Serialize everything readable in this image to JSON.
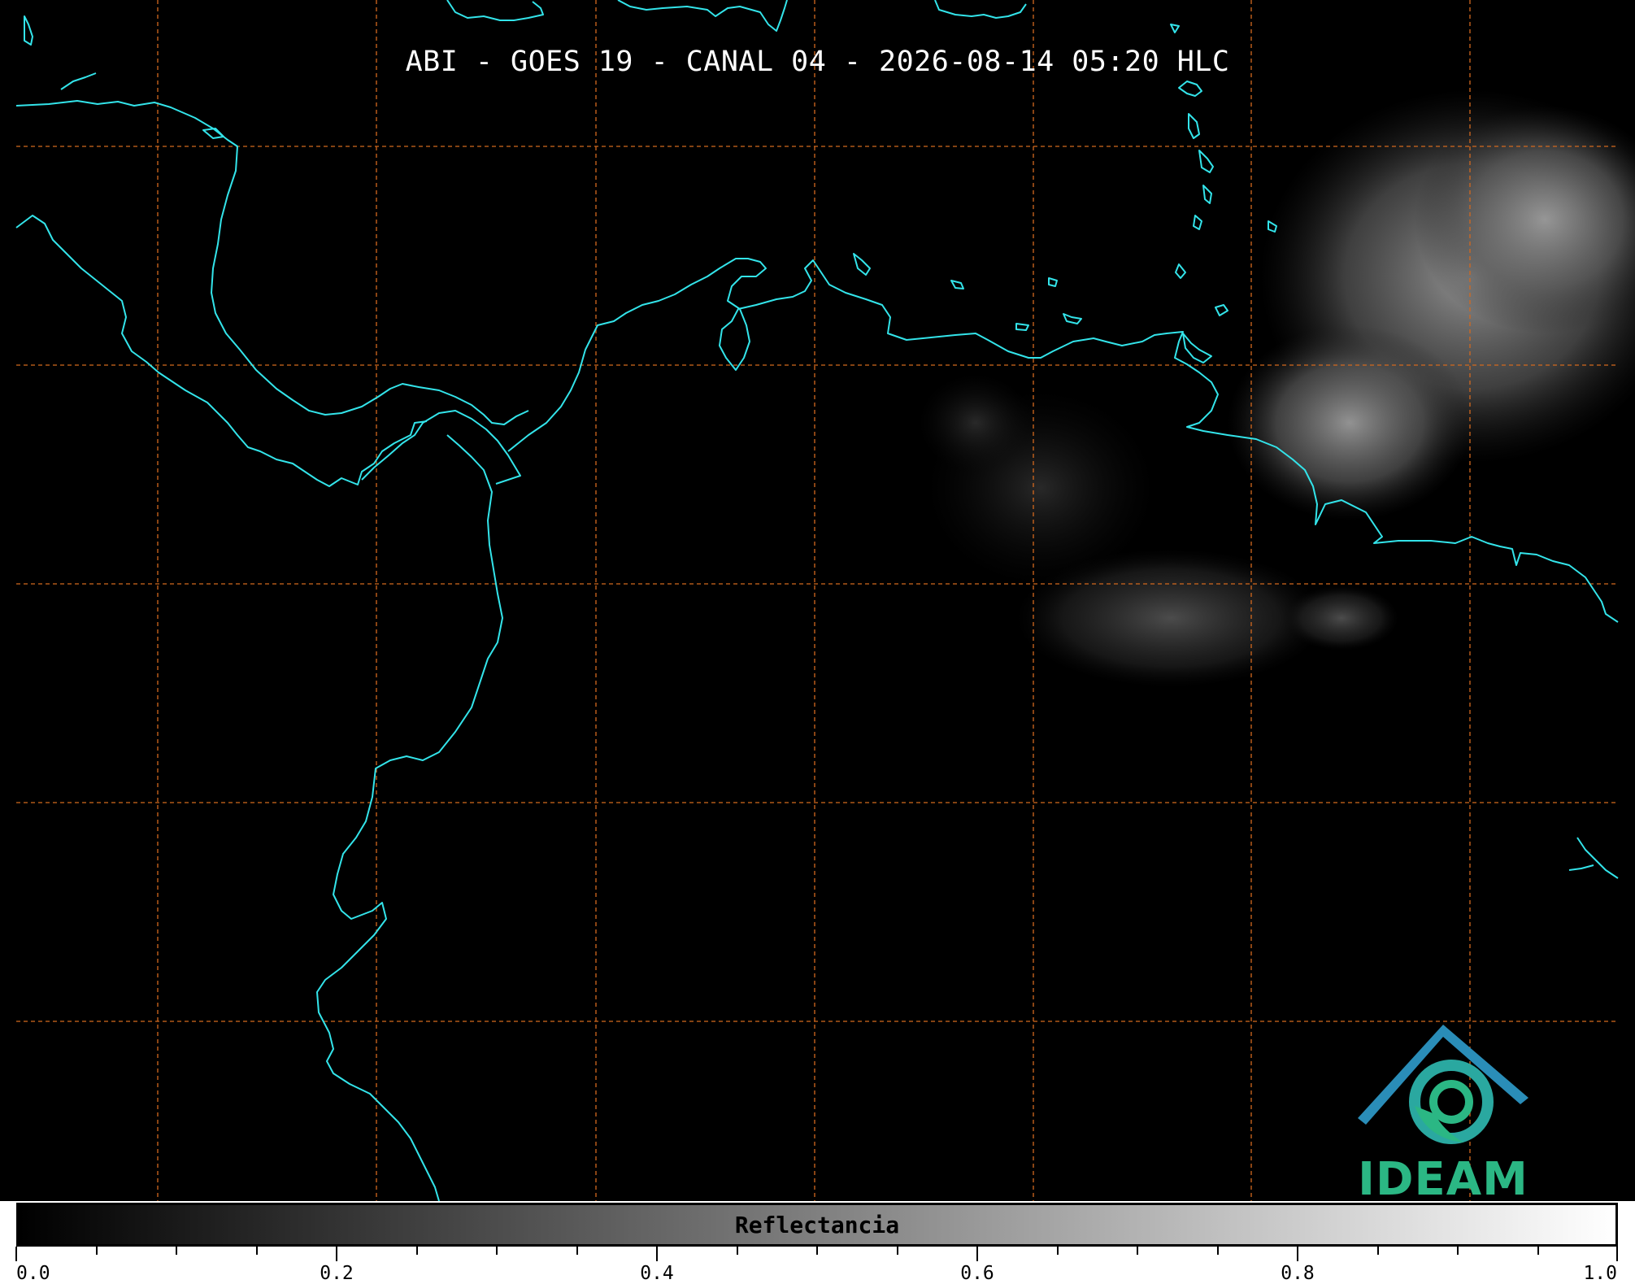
{
  "map": {
    "title": "ABI - GOES 19 - CANAL 04 - 2026-08-14 05:20 HLC",
    "background_color": "#000000",
    "coastline_color": "#33e4ea",
    "gridline_color": "#d3691e",
    "gridline_style": "dashed"
  },
  "colorbar": {
    "label": "Reflectancia",
    "colormap": "grayscale",
    "range": [
      0.0,
      1.0
    ],
    "tick_labels": [
      "0.0",
      "0.2",
      "0.4",
      "0.6",
      "0.8",
      "1.0"
    ]
  },
  "logo": {
    "text": "IDEAM",
    "color": "#2bb784"
  }
}
